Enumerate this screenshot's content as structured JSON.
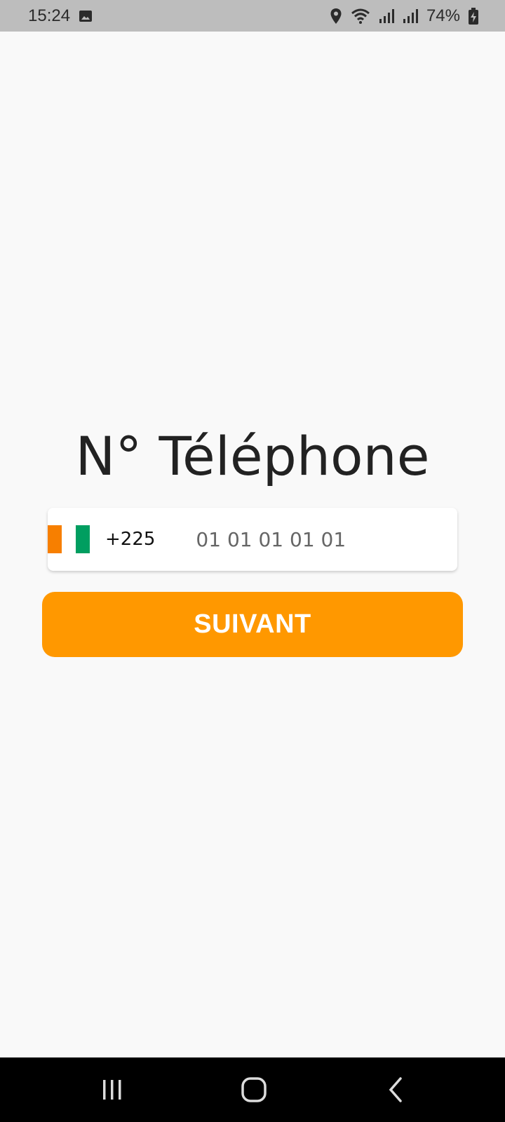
{
  "status_bar": {
    "time": "15:24",
    "battery": "74%",
    "icons": [
      "image-icon",
      "location-icon",
      "wifi-icon",
      "signal-icon",
      "signal-icon",
      "battery-charging-icon"
    ]
  },
  "screen": {
    "title": "N° Téléphone",
    "phone": {
      "country_flag": "cote-divoire-flag-icon",
      "dial_code": "+225",
      "placeholder": "01 01 01 01 01",
      "value": ""
    },
    "next_button_label": "SUIVANT",
    "accent_color": "#ff9800"
  },
  "nav_bar": {
    "buttons": [
      "recent-apps-icon",
      "home-icon",
      "back-icon"
    ]
  }
}
